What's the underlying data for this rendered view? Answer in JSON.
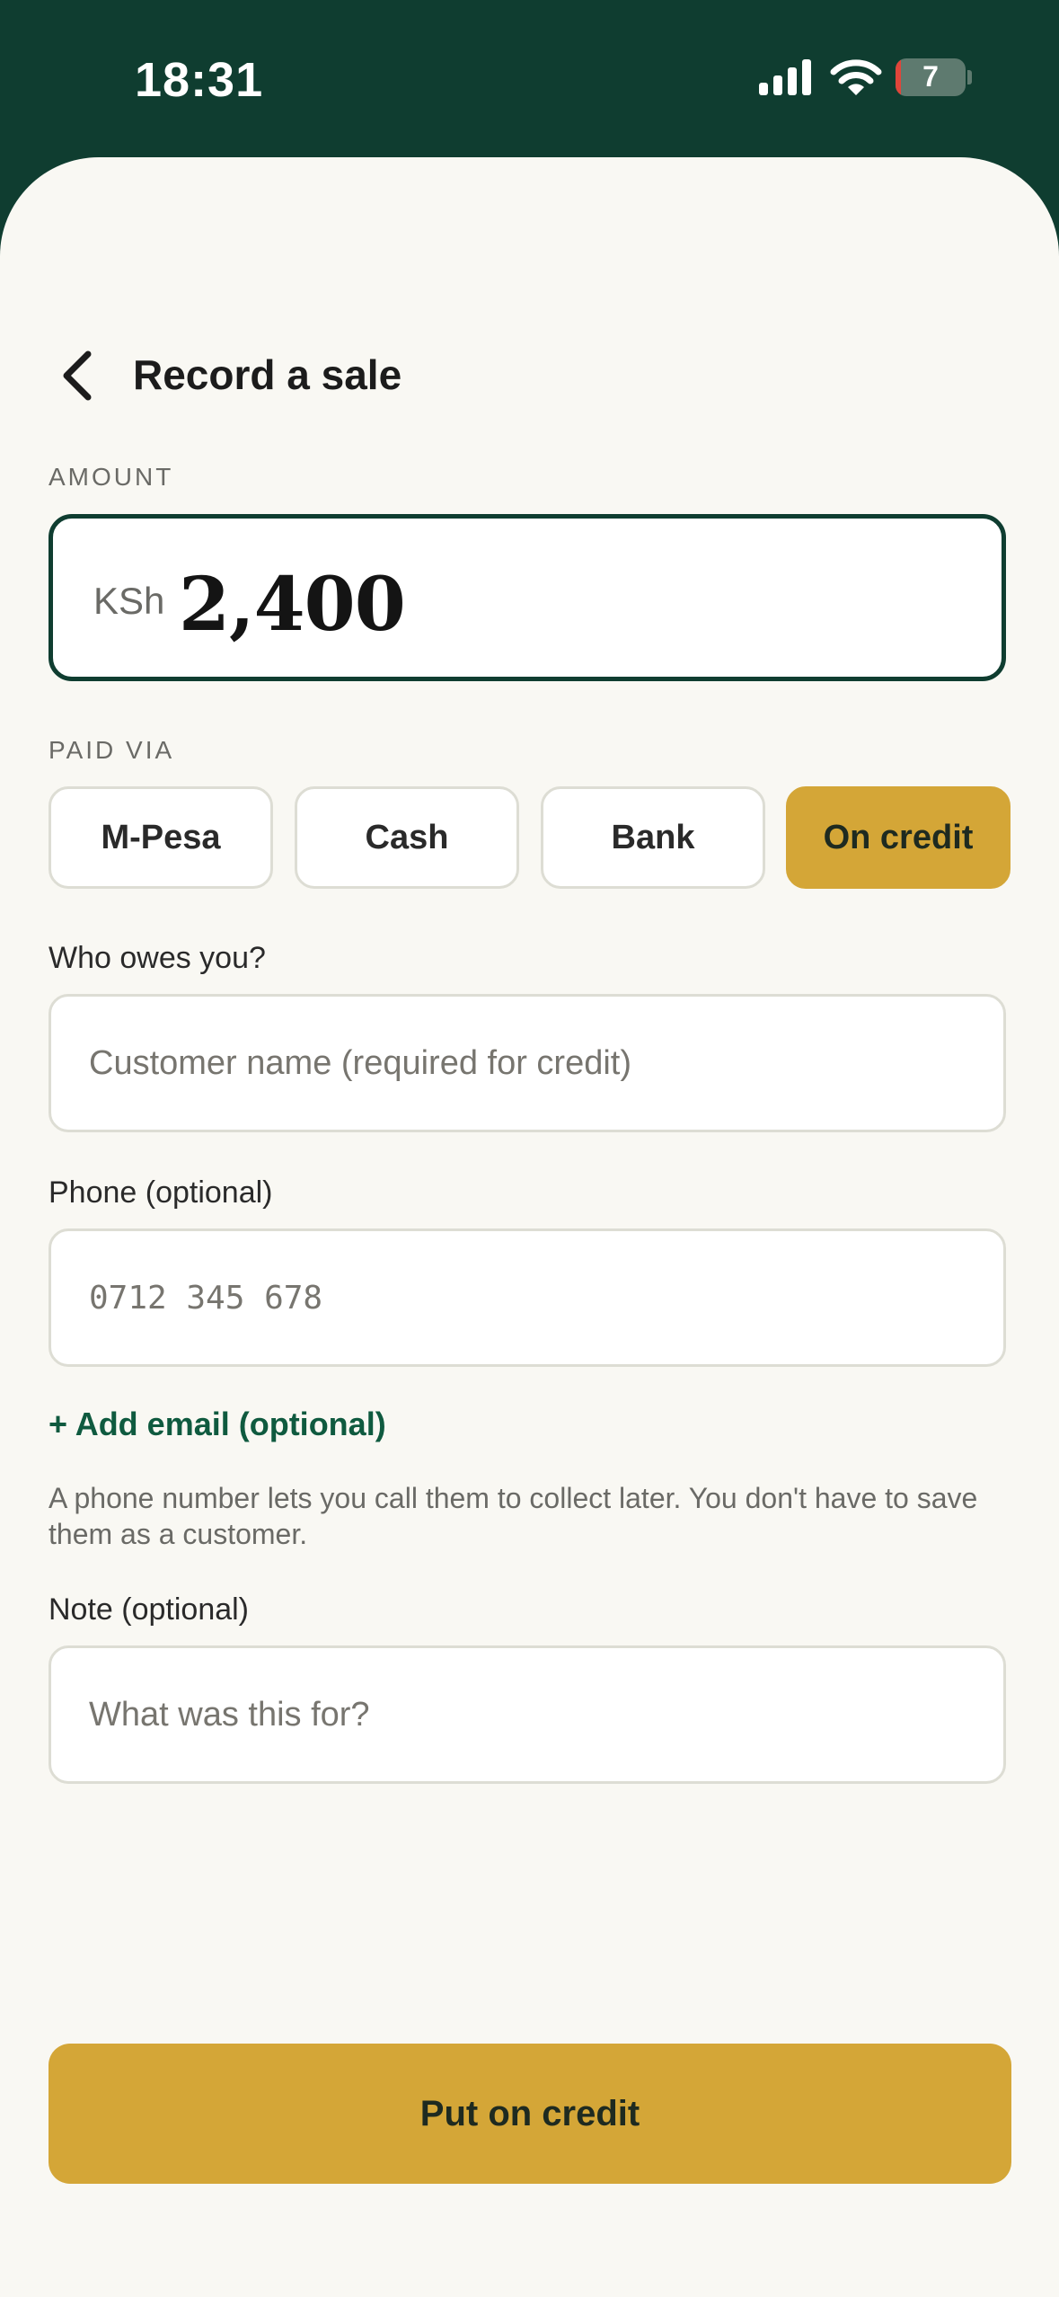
{
  "status_bar": {
    "time": "18:31",
    "battery": "7"
  },
  "header": {
    "title": "Record a sale"
  },
  "amount": {
    "label": "AMOUNT",
    "currency": "KSh",
    "value": "2,400"
  },
  "paid_via": {
    "label": "PAID VIA",
    "options": [
      "M-Pesa",
      "Cash",
      "Bank",
      "On credit"
    ],
    "selected": "On credit"
  },
  "customer": {
    "label": "Who owes you?",
    "placeholder": "Customer name (required for credit)"
  },
  "phone": {
    "label": "Phone (optional)",
    "placeholder": "0712 345 678"
  },
  "add_email": "+ Add email (optional)",
  "helper": "A phone number lets you call them to collect later. You don't have to save them as a customer.",
  "note": {
    "label": "Note (optional)",
    "placeholder": "What was this for?"
  },
  "submit": {
    "label": "Put on credit"
  },
  "colors": {
    "brand": "#0f3d30",
    "accent": "#d4a637",
    "background": "#f9f8f3"
  }
}
